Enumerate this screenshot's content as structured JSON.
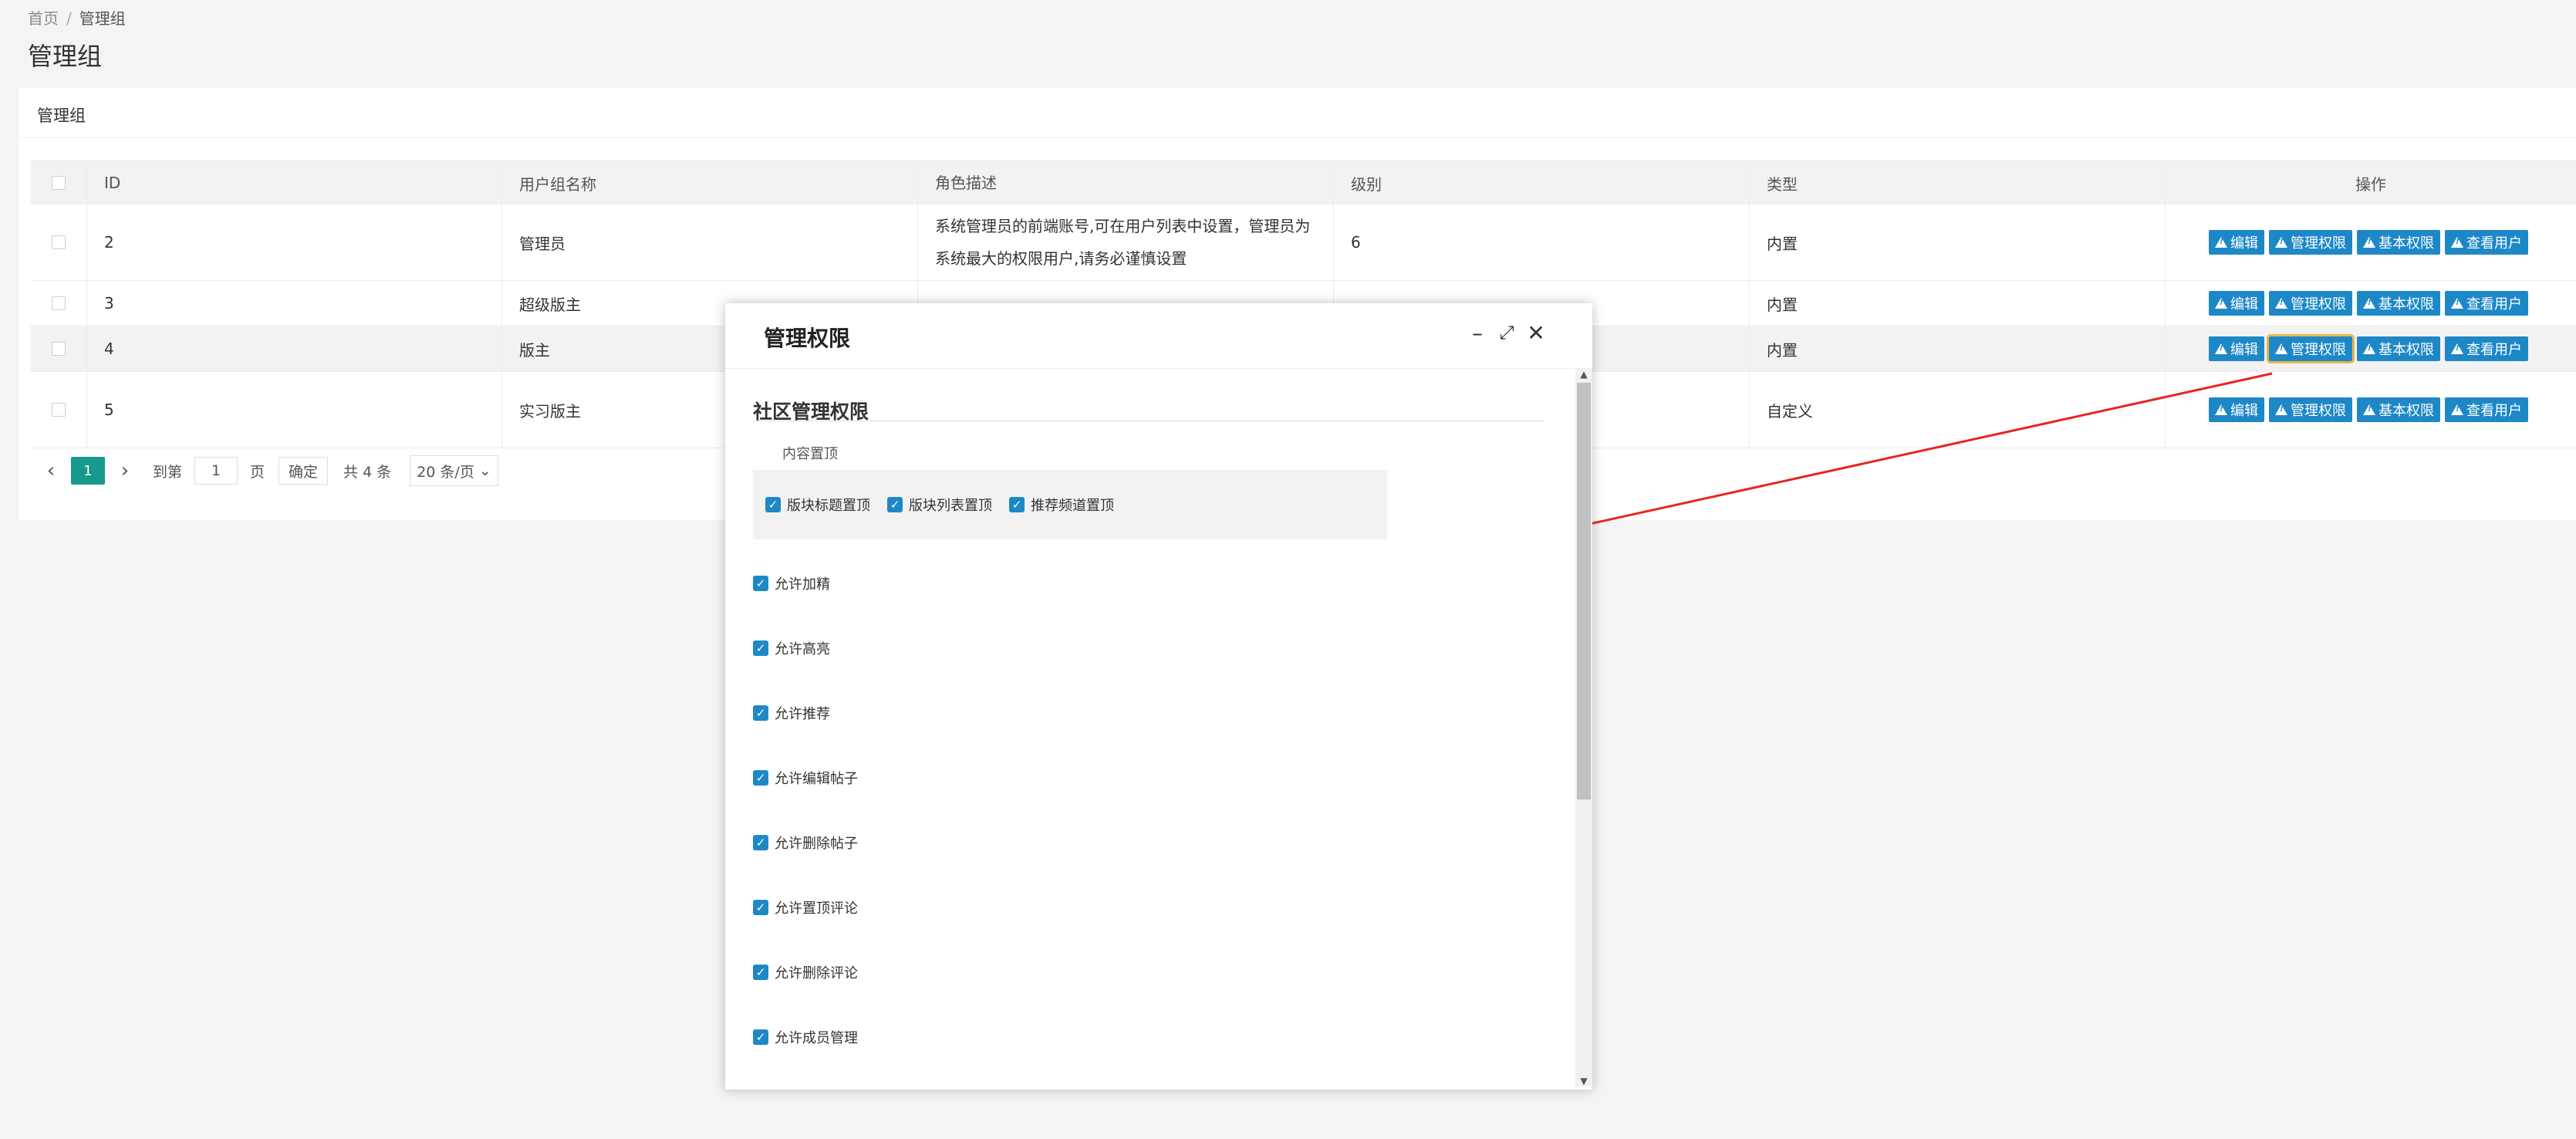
{
  "breadcrumb": {
    "home": "首页",
    "current": "管理组"
  },
  "page_title": "管理组",
  "card_title": "管理组",
  "table": {
    "headers": {
      "id": "ID",
      "name": "用户组名称",
      "desc": "角色描述",
      "level": "级别",
      "type": "类型",
      "ops": "操作"
    },
    "rows": [
      {
        "id": "2",
        "name": "管理员",
        "desc": "系统管理员的前端账号,可在用户列表中设置，管理员为系统最大的权限用户,请务必谨慎设置",
        "level": "6",
        "type": "内置"
      },
      {
        "id": "3",
        "name": "超级版主",
        "desc": "",
        "level": "",
        "type": "内置"
      },
      {
        "id": "4",
        "name": "版主",
        "desc": "",
        "level": "",
        "type": "内置"
      },
      {
        "id": "5",
        "name": "实习版主",
        "desc": "",
        "level": "",
        "type": "自定义"
      }
    ],
    "row_actions": {
      "edit": "编辑",
      "manage": "管理权限",
      "basic": "基本权限",
      "view_users": "查看用户"
    }
  },
  "pager": {
    "current": "1",
    "goto_label": "到第",
    "goto_value": "1",
    "page_unit": "页",
    "confirm": "确定",
    "total": "共 4 条",
    "page_size": "20 条/页"
  },
  "dialog": {
    "title": "管理权限",
    "section_title": "社区管理权限",
    "group_label": "内容置顶",
    "group_options": [
      "版块标题置顶",
      "版块列表置顶",
      "推荐频道置顶"
    ],
    "permissions": [
      "允许加精",
      "允许高亮",
      "允许推荐",
      "允许编辑帖子",
      "允许删除帖子",
      "允许置顶评论",
      "允许删除评论",
      "允许成员管理"
    ]
  },
  "icons": {
    "action": "warning-icon",
    "minimize": "minimize-icon",
    "maximize": "maximize-icon",
    "close": "close-icon"
  },
  "colors": {
    "primary": "#1e88c7",
    "pager_active": "#17998b",
    "annotation": "#e8251f"
  }
}
